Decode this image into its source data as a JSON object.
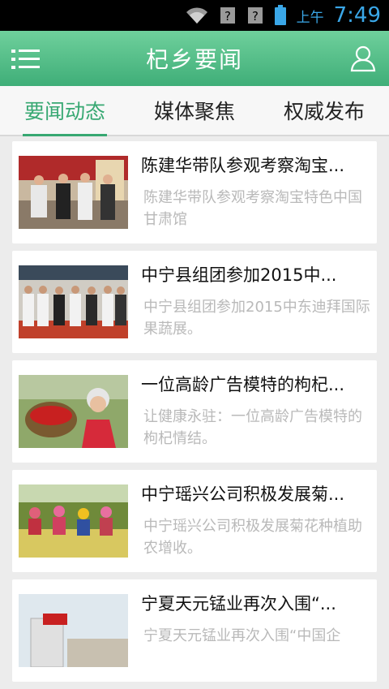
{
  "status_bar": {
    "icons": [
      "wifi-icon",
      "signal-unknown-icon",
      "signal-unknown-icon",
      "battery-icon"
    ],
    "ampm": "上午",
    "time": "7:49"
  },
  "header": {
    "title": "杞乡要闻",
    "menu_icon": "menu-list-icon",
    "user_icon": "user-icon"
  },
  "tabs": [
    {
      "label": "要闻动态",
      "active": true
    },
    {
      "label": "媒体聚焦",
      "active": false
    },
    {
      "label": "权威发布",
      "active": false
    }
  ],
  "news": [
    {
      "title": "陈建华带队参观考察淘宝...",
      "summary": "陈建华带队参观考察淘宝特色中国甘肃馆"
    },
    {
      "title": "中宁县组团参加2015中...",
      "summary": "中宁县组团参加2015中东迪拜国际果蔬展。"
    },
    {
      "title": "一位高龄广告模特的枸杞...",
      "summary": "让健康永驻：一位高龄广告模特的枸杞情结。"
    },
    {
      "title": "中宁瑶兴公司积极发展菊...",
      "summary": "中宁瑶兴公司积极发展菊花种植助农增收。"
    },
    {
      "title": "宁夏天元锰业再次入围“...",
      "summary": "宁夏天元锰业再次入围“中国企"
    }
  ],
  "colors": {
    "header_top": "#6fd09c",
    "header_bottom": "#3fae78",
    "tab_active": "#37a872",
    "status_icons": "#3aa7e8"
  }
}
